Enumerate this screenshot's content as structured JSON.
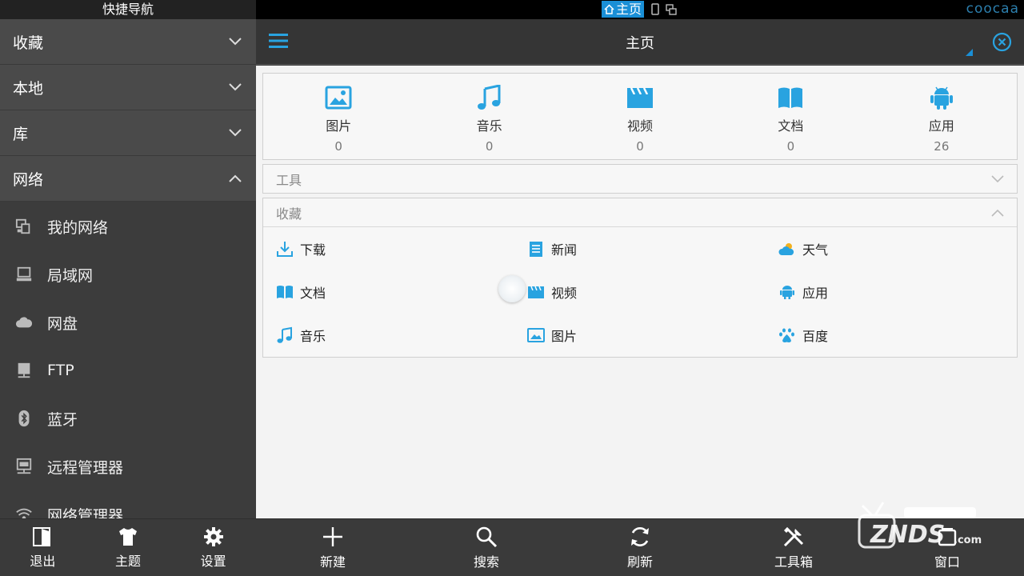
{
  "sidebar": {
    "title": "快捷导航",
    "sections": [
      {
        "label": "收藏",
        "expanded": false
      },
      {
        "label": "本地",
        "expanded": false
      },
      {
        "label": "库",
        "expanded": false
      },
      {
        "label": "网络",
        "expanded": true
      }
    ],
    "network_items": [
      {
        "label": "我的网络",
        "icon": "my-network-icon"
      },
      {
        "label": "局域网",
        "icon": "lan-icon"
      },
      {
        "label": "网盘",
        "icon": "cloud-icon"
      },
      {
        "label": "FTP",
        "icon": "ftp-icon"
      },
      {
        "label": "蓝牙",
        "icon": "bluetooth-icon"
      },
      {
        "label": "远程管理器",
        "icon": "remote-manager-icon"
      },
      {
        "label": "网络管理器",
        "icon": "wifi-icon"
      }
    ],
    "bottom": [
      {
        "label": "退出",
        "icon": "exit-icon"
      },
      {
        "label": "主题",
        "icon": "theme-icon"
      },
      {
        "label": "设置",
        "icon": "settings-icon"
      }
    ]
  },
  "statusbar": {
    "home_tab": "主页",
    "brand": "coocaa"
  },
  "header": {
    "title": "主页"
  },
  "categories": [
    {
      "label": "图片",
      "count": "0",
      "icon": "image-icon"
    },
    {
      "label": "音乐",
      "count": "0",
      "icon": "music-icon"
    },
    {
      "label": "视频",
      "count": "0",
      "icon": "video-icon"
    },
    {
      "label": "文档",
      "count": "0",
      "icon": "book-icon"
    },
    {
      "label": "应用",
      "count": "26",
      "icon": "android-icon"
    }
  ],
  "tools": {
    "title": "工具"
  },
  "favorites": {
    "title": "收藏",
    "items": [
      {
        "label": "下载",
        "icon": "download-icon"
      },
      {
        "label": "新闻",
        "icon": "news-icon"
      },
      {
        "label": "天气",
        "icon": "weather-icon"
      },
      {
        "label": "文档",
        "icon": "book-icon"
      },
      {
        "label": "视频",
        "icon": "video-icon"
      },
      {
        "label": "应用",
        "icon": "android-icon"
      },
      {
        "label": "音乐",
        "icon": "music-icon"
      },
      {
        "label": "图片",
        "icon": "image-icon"
      },
      {
        "label": "百度",
        "icon": "baidu-icon"
      }
    ]
  },
  "toolbar": [
    {
      "label": "新建",
      "icon": "plus-icon"
    },
    {
      "label": "搜索",
      "icon": "search-icon"
    },
    {
      "label": "刷新",
      "icon": "refresh-icon"
    },
    {
      "label": "工具箱",
      "icon": "toolbox-icon"
    },
    {
      "label": "窗口",
      "icon": "window-icon"
    }
  ],
  "colors": {
    "accent": "#1a8fd6",
    "icon_blue": "#29a3e0",
    "sidebar_bg": "#3c3c3c",
    "header_bg": "#353535",
    "content_bg": "#f3f3f3"
  }
}
